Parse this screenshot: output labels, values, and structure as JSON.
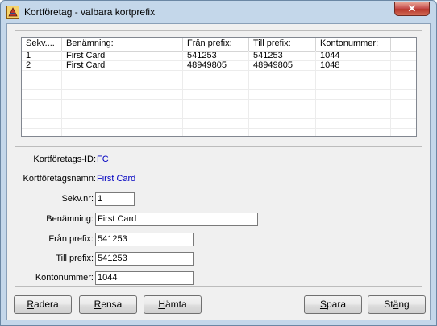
{
  "window": {
    "title": "Kortföretag - valbara kortprefix",
    "close_symbol": "✕",
    "icon": "card-app-icon"
  },
  "list": {
    "columns": [
      "Sekv....",
      "Benämning:",
      "Från prefix:",
      "Till prefix:",
      "Kontonummer:"
    ],
    "rows": [
      [
        "1",
        "First Card",
        "541253",
        "541253",
        "1044"
      ],
      [
        "2",
        "First Card",
        "48949805",
        "48949805",
        "1048"
      ]
    ]
  },
  "details": {
    "company_id_label": "Kortföretags-ID:",
    "company_id_value": "FC",
    "company_name_label": "Kortföretagsnamn:",
    "company_name_value": "First Card",
    "seq_label": "Sekv.nr:",
    "seq_value": "1",
    "name_label": "Benämning:",
    "name_value": "First Card",
    "from_label": "Från prefix:",
    "from_value": "541253",
    "to_label": "Till prefix:",
    "to_value": "541253",
    "account_label": "Kontonummer:",
    "account_value": "1044"
  },
  "buttons": {
    "delete": {
      "mnemonic": "R",
      "rest": "adera"
    },
    "clear": {
      "mnemonic": "R",
      "rest": "ensa"
    },
    "fetch": {
      "mnemonic": "H",
      "rest": "ämta"
    },
    "save": {
      "mnemonic": "S",
      "rest": "para"
    },
    "close": {
      "prefix": "St",
      "mnemonic": "ä",
      "rest": "ng"
    }
  },
  "colors": {
    "link_value": "#0000c0",
    "close_button": "#c75050",
    "window_frame": "#c4d7ea"
  }
}
